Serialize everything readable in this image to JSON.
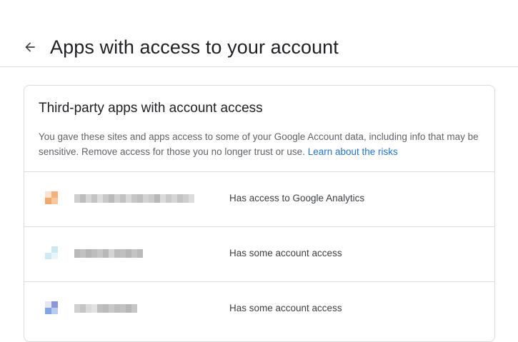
{
  "header": {
    "title": "Apps with access to your account",
    "back_icon": "arrow-back-icon"
  },
  "card": {
    "title": "Third-party apps with account access",
    "description": "You gave these sites and apps access to some of your Google Account data, including info that may be sensitive. Remove access for those you no longer trust or use.",
    "learn_link": "Learn about the risks"
  },
  "apps": [
    {
      "access": "Has access to Google Analytics",
      "icon_colors": [
        "#fbe3cf",
        "#f6b07a",
        "#f4a86a",
        "#f8c89c"
      ],
      "name_shades": [
        "#cfcfcf",
        "#bdbdbd",
        "#d6d6d6",
        "#c4c4c4",
        "#dcdcdc",
        "#c8c8c8",
        "#bababa",
        "#d0d0d0",
        "#c2c2c2",
        "#d9d9d9",
        "#c6c6c6",
        "#bfbfbf",
        "#d3d3d3",
        "#cacaca",
        "#b8b8b8",
        "#dadada",
        "#c9c9c9",
        "#d5d5d5",
        "#c3c3c3",
        "#cdcdcd",
        "#dcdcdc"
      ]
    },
    {
      "access": "Has some account access",
      "icon_colors": [
        "#ffffff",
        "#c9e9f5",
        "#cdeaf6",
        "#e8f5fa"
      ],
      "name_shades": [
        "#b9b9b9",
        "#c1c1c1",
        "#b5b5b5",
        "#bdbdbd",
        "#c6c6c6",
        "#b8b8b8",
        "#d4d4d4",
        "#bcbcbc",
        "#c0c0c0",
        "#b6b6b6",
        "#c4c4c4",
        "#bababa"
      ]
    },
    {
      "access": "Has some account access",
      "icon_colors": [
        "#e6e6f4",
        "#8a96d8",
        "#7fa6e6",
        "#b6cdf0"
      ],
      "name_shades": [
        "#d0d0d0",
        "#c4c4c4",
        "#dadada",
        "#e3e3e3",
        "#c0c0c0",
        "#bababa",
        "#c8c8c8",
        "#bdbdbd",
        "#c2c2c2",
        "#b7b7b7",
        "#c6c6c6"
      ]
    }
  ]
}
